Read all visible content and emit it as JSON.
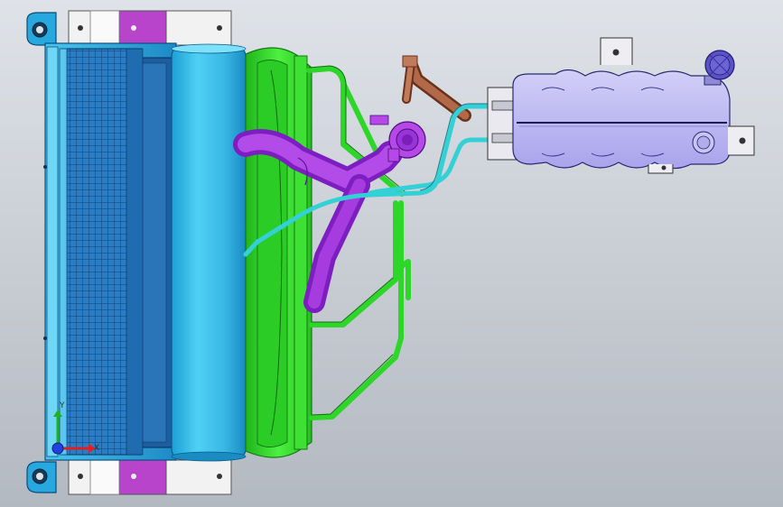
{
  "app": {
    "view": "cad-3d-viewport"
  },
  "scene": {
    "parts": [
      {
        "id": "radiator-core",
        "color": "#1d6fb5"
      },
      {
        "id": "radiator-frame",
        "color": "#22a6d6"
      },
      {
        "id": "header-tank",
        "color": "#3cc4ec"
      },
      {
        "id": "mount-brackets-white",
        "color": "#f4f4f4"
      },
      {
        "id": "mount-brackets-purple",
        "color": "#b844cc"
      },
      {
        "id": "fan-shroud",
        "color": "#37dc2d"
      },
      {
        "id": "frame-tubes",
        "color": "#2ed62a"
      },
      {
        "id": "coolant-hose-purple",
        "color": "#9a2bd8"
      },
      {
        "id": "hose-lines-cyan",
        "color": "#33d0d6"
      },
      {
        "id": "elbow-fitting",
        "color": "#a25a3a"
      },
      {
        "id": "expansion-tank",
        "color": "#b8b4f2"
      },
      {
        "id": "filler-cap",
        "color": "#5a52c8"
      }
    ],
    "background": {
      "top": "#dfe3e8",
      "bottom": "#b3b9c1"
    }
  },
  "triad": {
    "x_color": "#e02020",
    "y_color": "#20b020",
    "z_color": "#2040e0",
    "x_label": "X",
    "y_label": "Y"
  }
}
